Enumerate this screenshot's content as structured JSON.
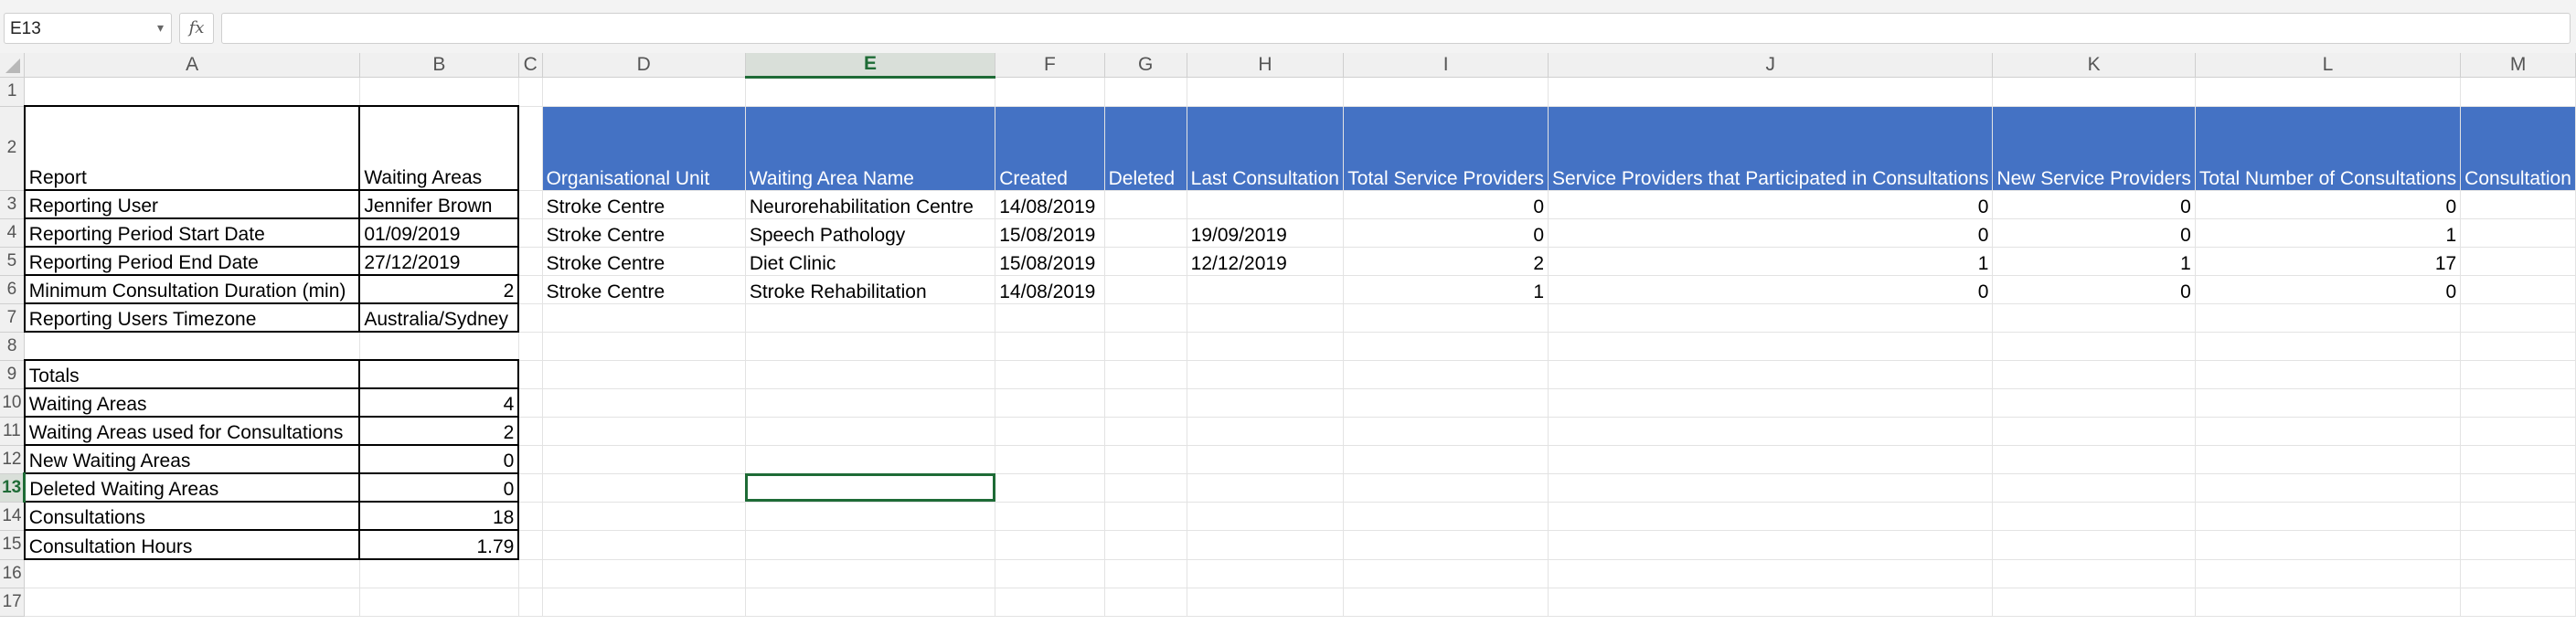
{
  "formula_bar": {
    "name_box": "E13",
    "fx_label": "fx",
    "formula": ""
  },
  "columns": [
    "A",
    "B",
    "C",
    "D",
    "E",
    "F",
    "G",
    "H",
    "I",
    "J",
    "K",
    "L",
    "M"
  ],
  "rows": [
    "1",
    "2",
    "3",
    "4",
    "5",
    "6",
    "7",
    "8",
    "9",
    "10",
    "11",
    "12",
    "13",
    "14",
    "15",
    "16",
    "17"
  ],
  "selected_cell": "E13",
  "report": {
    "header_a": "Report",
    "header_b": "Waiting Areas",
    "items": [
      {
        "label": "Reporting User",
        "value": "Jennifer Brown"
      },
      {
        "label": "Reporting Period Start Date",
        "value": "01/09/2019"
      },
      {
        "label": "Reporting Period End Date",
        "value": "27/12/2019"
      },
      {
        "label": "Minimum Consultation Duration (min)",
        "value": "2"
      },
      {
        "label": "Reporting Users Timezone",
        "value": "Australia/Sydney"
      }
    ]
  },
  "totals": {
    "title": "Totals",
    "items": [
      {
        "label": "Waiting Areas",
        "value": "4"
      },
      {
        "label": "Waiting Areas used for Consultations",
        "value": "2"
      },
      {
        "label": "New Waiting Areas",
        "value": "0"
      },
      {
        "label": "Deleted Waiting Areas",
        "value": "0"
      },
      {
        "label": "Consultations",
        "value": "18"
      },
      {
        "label": "Consultation Hours",
        "value": "1.79"
      }
    ]
  },
  "table": {
    "headers": [
      "Organisational Unit",
      "Waiting Area Name",
      "Created",
      "Deleted",
      "Last Consultation",
      "Total Service Providers",
      "Service Providers that Participated in Consultations",
      "New Service Providers",
      "Total Number of Consultations",
      "Consultation"
    ],
    "rows": [
      [
        "Stroke Centre",
        "Neurorehabilitation Centre",
        "14/08/2019",
        "",
        "",
        "0",
        "0",
        "0",
        "0",
        ""
      ],
      [
        "Stroke Centre",
        "Speech Pathology",
        "15/08/2019",
        "",
        "19/09/2019",
        "0",
        "0",
        "0",
        "1",
        ""
      ],
      [
        "Stroke Centre",
        "Diet Clinic",
        "15/08/2019",
        "",
        "12/12/2019",
        "2",
        "1",
        "1",
        "17",
        ""
      ],
      [
        "Stroke Centre",
        "Stroke Rehabilitation",
        "14/08/2019",
        "",
        "",
        "1",
        "0",
        "0",
        "0",
        ""
      ]
    ]
  }
}
